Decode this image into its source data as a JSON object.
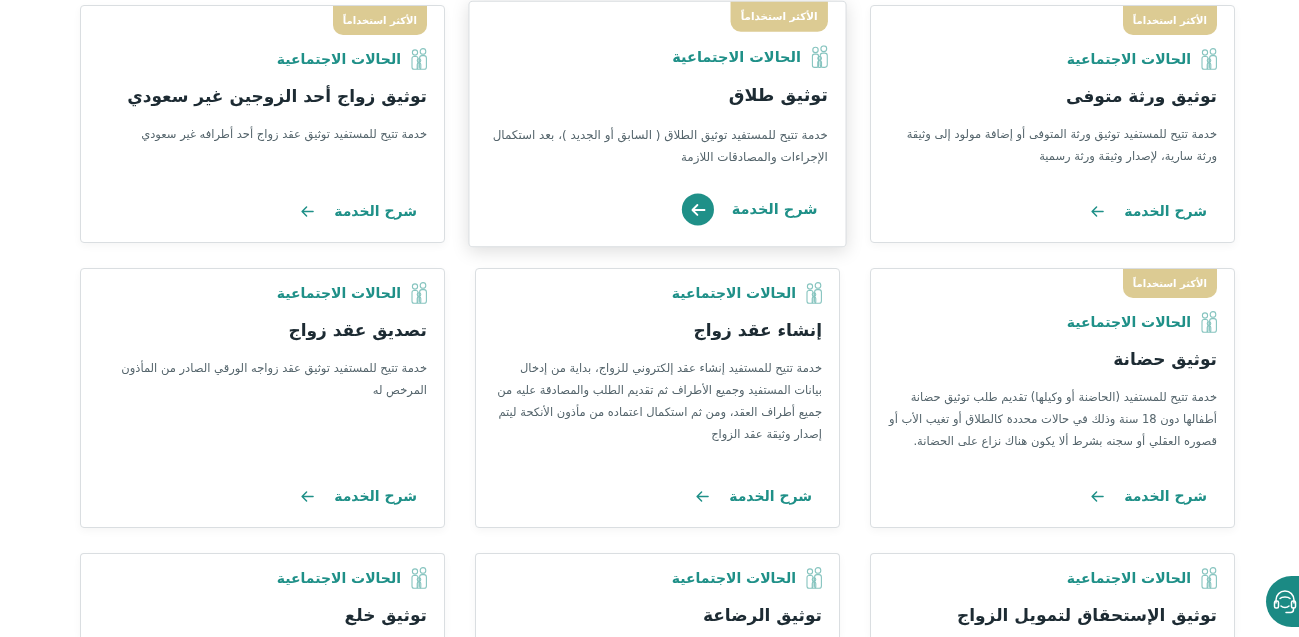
{
  "cards": [
    {
      "badge": "الأكثر استخداماً",
      "category": "الحالات الاجتماعية",
      "title": "توثيق ورثة متوفى",
      "description": "خدمة تتيح للمستفيد توثيق ورثة المتوفى أو إضافة مولود إلى وثيقة ورثة سارية، لإصدار وثيقة ورثة رسمية",
      "link": "شرح الخدمة",
      "highlighted": false
    },
    {
      "badge": "الأكثر استخداماً",
      "category": "الحالات الاجتماعية",
      "title": "توثيق طلاق",
      "description": "خدمة تتيح للمستفيد توثيق الطلاق ( السابق أو الجديد )، بعد استكمال الإجراءات والمصادقات اللازمة",
      "link": "شرح الخدمة",
      "highlighted": true
    },
    {
      "badge": "الأكثر استخداماً",
      "category": "الحالات الاجتماعية",
      "title": "توثيق زواج أحد الزوجين غير سعودي",
      "description": "خدمة تتيح للمستفيد توثيق عقد زواج أحد أطرافه غير سعودي",
      "link": "شرح الخدمة",
      "highlighted": false
    },
    {
      "badge": "الأكثر استخداماً",
      "category": "الحالات الاجتماعية",
      "title": "توثيق حضانة",
      "description": "خدمة تتيح للمستفيد (الحاضنة أو وكيلها) تقديم طلب توثيق حضانة أطفالها دون 18 سنة وذلك في حالات محددة كالطلاق أو تغيب الأب أو قصوره العقلي أو سجنه بشرط ألا يكون هناك نزاع على الحضانة.",
      "link": "شرح الخدمة",
      "highlighted": false
    },
    {
      "category": "الحالات الاجتماعية",
      "title": "إنشاء عقد زواج",
      "description": "خدمة تتيح للمستفيد إنشاء عقد إلكتروني للزواج، بداية من إدخال بيانات المستفيد وجميع الأطراف ثم تقديم الطلب والمصادقة عليه من جميع أطراف العقد، ومن ثم استكمال اعتماده من مأذون الأنكحة ليتم إصدار وثيقة عقد الزواج",
      "link": "شرح الخدمة",
      "highlighted": false
    },
    {
      "category": "الحالات الاجتماعية",
      "title": "تصديق عقد زواج",
      "description": "خدمة تتيح للمستفيد توثيق عقد زواجه الورقي الصادر من المأذون المرخص له",
      "link": "شرح الخدمة",
      "highlighted": false
    },
    {
      "category": "الحالات الاجتماعية",
      "title": "توثيق الإستحقاق لتمويل الزواج",
      "highlighted": false
    },
    {
      "category": "الحالات الاجتماعية",
      "title": "توثيق الرضاعة",
      "highlighted": false
    },
    {
      "category": "الحالات الاجتماعية",
      "title": "توثيق خلع",
      "highlighted": false
    }
  ]
}
